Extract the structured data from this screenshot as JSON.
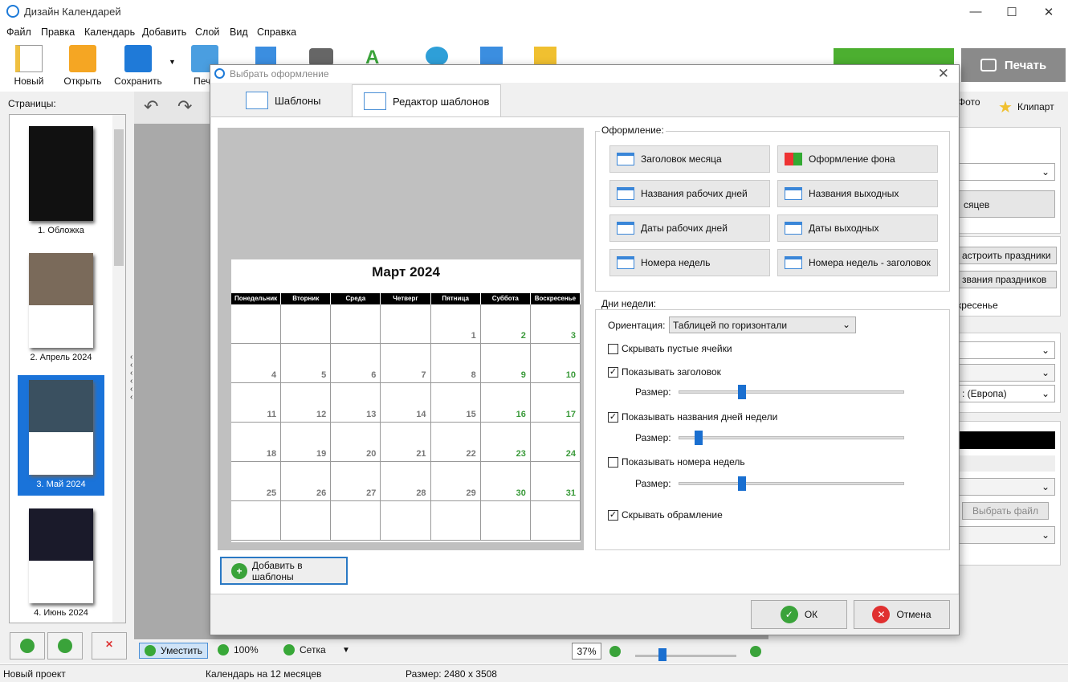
{
  "app": {
    "title": "Дизайн Календарей"
  },
  "menu": [
    "Файл",
    "Правка",
    "Календарь",
    "Добавить",
    "Слой",
    "Вид",
    "Справка"
  ],
  "toolbar": {
    "new": "Новый",
    "open": "Открыть",
    "save": "Сохранить",
    "print_partial": "Печа",
    "print_button": "Печать"
  },
  "left": {
    "pages_label": "Страницы:",
    "pages": [
      "1. Обложка",
      "2. Апрель 2024",
      "3. Май 2024",
      "4. Июнь 2024"
    ],
    "selected": 2
  },
  "right": {
    "tab_photo": "Фото",
    "tab_clipart": "Клипарт",
    "btn_months": "сяцев",
    "btn_holidays": "астроить праздники",
    "btn_holiday_names": "звания праздников",
    "sunday": "кресенье",
    "select_europe": ": (Европа)",
    "btn_choose_file": "Выбрать файл"
  },
  "dialog": {
    "title": "Выбрать оформление",
    "tabs": [
      "Шаблоны",
      "Редактор шаблонов"
    ],
    "active_tab": 1,
    "calendar": {
      "title": "Март 2024",
      "weekdays": [
        "Понедельник",
        "Вторник",
        "Среда",
        "Четверг",
        "Пятница",
        "Суббота",
        "Воскресенье"
      ],
      "rows": [
        [
          "",
          "",
          "",
          "",
          "1",
          "2",
          "3"
        ],
        [
          "4",
          "5",
          "6",
          "7",
          "8",
          "9",
          "10"
        ],
        [
          "11",
          "12",
          "13",
          "14",
          "15",
          "16",
          "17"
        ],
        [
          "18",
          "19",
          "20",
          "21",
          "22",
          "23",
          "24"
        ],
        [
          "25",
          "26",
          "27",
          "28",
          "29",
          "30",
          "31"
        ],
        [
          "",
          "",
          "",
          "",
          "",
          "",
          ""
        ]
      ]
    },
    "design": {
      "group_label": "Оформление:",
      "buttons": [
        "Заголовок месяца",
        "Оформление фона",
        "Названия рабочих дней",
        "Названия выходных",
        "Даты рабочих дней",
        "Даты выходных",
        "Номера недель",
        "Номера недель - заголовок"
      ]
    },
    "weekdays_group": {
      "label": "Дни недели:",
      "orientation_label": "Ориентация:",
      "orientation_value": "Таблицей по горизонтали",
      "hide_empty": "Скрывать пустые ячейки",
      "hide_empty_checked": false,
      "show_header": "Показывать заголовок",
      "show_header_checked": true,
      "size_label": "Размер:",
      "show_day_names": "Показывать названия дней недели",
      "show_day_names_checked": true,
      "show_week_numbers": "Показывать номера недель",
      "show_week_numbers_checked": false,
      "hide_frame": "Скрывать обрамление",
      "hide_frame_checked": true,
      "slider_header": 0.27,
      "slider_daynames": 0.07,
      "slider_weeknum": 0.27
    },
    "add_templates": "Добавить в шаблоны",
    "ok": "ОК",
    "cancel": "Отмена"
  },
  "bottom": {
    "fit": "Уместить",
    "zoom100": "100%",
    "grid": "Сетка",
    "zoom_value": "37%",
    "zoom_slider": 0.25
  },
  "status": {
    "project": "Новый проект",
    "calendar": "Календарь на 12 месяцев",
    "size": "Размер: 2480 x 3508"
  },
  "colors": {
    "accent": "#1a73d9",
    "green": "#4caf30",
    "weekend": "#3a9a3a"
  }
}
